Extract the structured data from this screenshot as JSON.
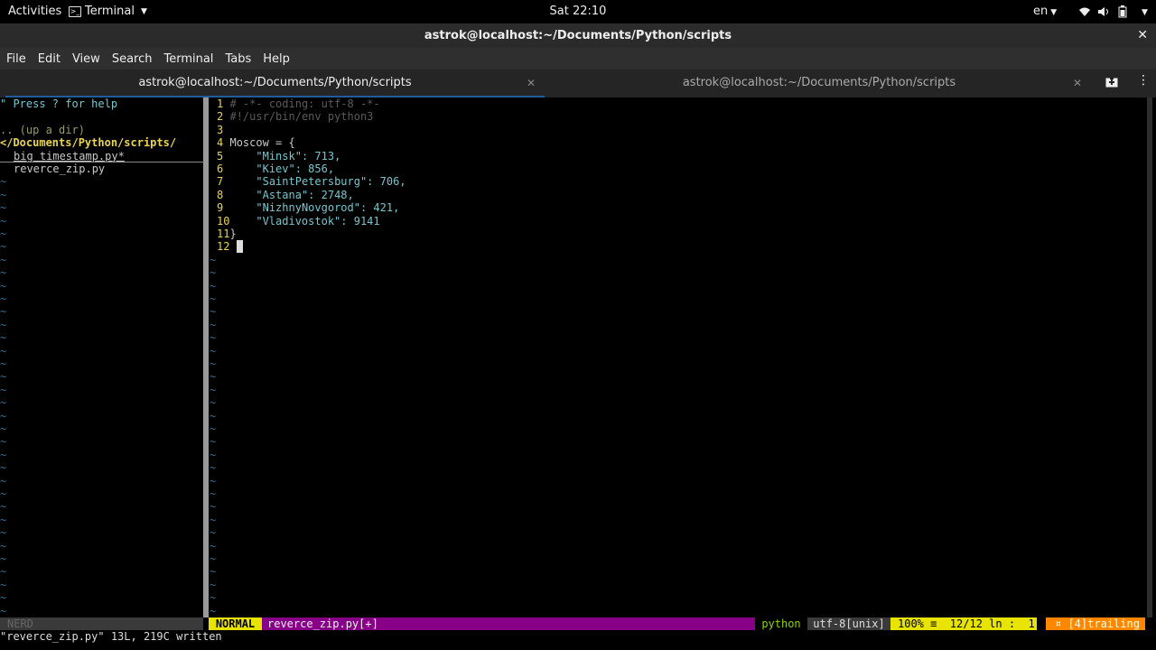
{
  "topbar": {
    "activities": "Activities",
    "app_name": "Terminal",
    "clock": "Sat 22:10",
    "language": "en"
  },
  "window": {
    "title": "astrok@localhost:~/Documents/Python/scripts",
    "close_glyph": "✕"
  },
  "menubar": [
    "File",
    "Edit",
    "View",
    "Search",
    "Terminal",
    "Tabs",
    "Help"
  ],
  "tabs": [
    {
      "label": "astrok@localhost:~/Documents/Python/scripts",
      "active": true
    },
    {
      "label": "astrok@localhost:~/Documents/Python/scripts",
      "active": false
    }
  ],
  "nerdtree": {
    "help": "\" Press ? for help",
    "up_dir": ".. (up a dir)",
    "root": "</Documents/Python/scripts/",
    "files": [
      "big_timestamp.py*",
      "reverce_zip.py"
    ]
  },
  "editor": {
    "lines": [
      {
        "n": "1",
        "text": "# -*- coding: utf-8 -*-"
      },
      {
        "n": "2",
        "text": "#!/usr/bin/env python3"
      },
      {
        "n": "3",
        "text": ""
      },
      {
        "n": "4",
        "text": "Moscow = {"
      },
      {
        "n": "5",
        "text": "    \"Minsk\": 713,"
      },
      {
        "n": "6",
        "text": "    \"Kiev\": 856,"
      },
      {
        "n": "7",
        "text": "    \"SaintPetersburg\": 706,"
      },
      {
        "n": "8",
        "text": "    \"Astana\": 2748,"
      },
      {
        "n": "9",
        "text": "    \"NizhnyNovgorod\": 421,"
      },
      {
        "n": "10",
        "text": "    \"Vladivostok\": 9141"
      },
      {
        "n": "11",
        "text": "}"
      },
      {
        "n": "12",
        "text": ""
      }
    ]
  },
  "statusline": {
    "nerd": "NERD",
    "mode": "NORMAL",
    "file": "reverce_zip.py[+]",
    "filetype": "python",
    "encoding": "utf-8[unix]",
    "position": "100% ≡  12/12 ln :  1",
    "trailing": "¤ [4]trailing"
  },
  "cmdline": "\"reverce_zip.py\" 13L, 219C written",
  "colors": {
    "mode_bg": "#e8e400",
    "file_bg": "#870087",
    "trailing_bg": "#ff8700",
    "tab_underline": "#215d9c"
  }
}
